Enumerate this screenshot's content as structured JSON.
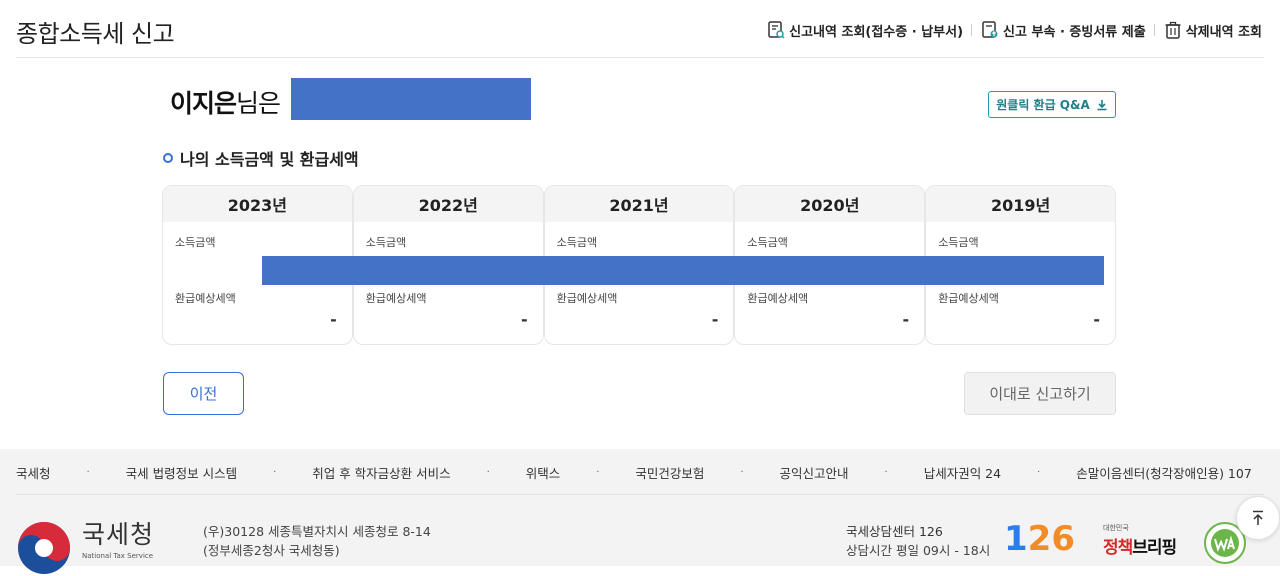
{
  "header": {
    "title": "종합소득세 신고",
    "links": {
      "history": "신고내역 조회(접수증 · 납부서)",
      "attach": "신고 부속 · 증빙서류 제출",
      "deleted": "삭제내역 조회"
    }
  },
  "main": {
    "user_name": "이지은",
    "user_suffix": "님은",
    "qa_button": "원클릭 환급 Q&A",
    "section_title": "나의 소득금액 및 환급세액",
    "years": [
      {
        "year": "2023년",
        "income_label": "소득금액",
        "refund_label": "환급예상세액",
        "refund_value": "-"
      },
      {
        "year": "2022년",
        "income_label": "소득금액",
        "refund_label": "환급예상세액",
        "refund_value": "-"
      },
      {
        "year": "2021년",
        "income_label": "소득금액",
        "refund_label": "환급예상세액",
        "refund_value": "-"
      },
      {
        "year": "2020년",
        "income_label": "소득금액",
        "refund_label": "환급예상세액",
        "refund_value": "-"
      },
      {
        "year": "2019년",
        "income_label": "소득금액",
        "refund_label": "환급예상세액",
        "refund_value": "-"
      }
    ],
    "prev_button": "이전",
    "submit_button": "이대로 신고하기"
  },
  "footer": {
    "links": [
      "국세청",
      "국세 법령정보 시스템",
      "취업 후 학자금상환 서비스",
      "위택스",
      "국민건강보험",
      "공익신고안내",
      "납세자권익 24",
      "손말이음센터(청각장애인용) 107"
    ],
    "separator": "·",
    "nts_name": "국세청",
    "nts_sub": "National Tax Service",
    "address_line1": "(우)30128 세종특별자치시 세종청로 8-14",
    "address_line2": "(정부세종2청사 국세청동)",
    "center_name": "국세상담센터 126",
    "center_hours": "상담시간 평일 09시 - 18시",
    "logo_126": "126",
    "briefing_small": "대한민국",
    "briefing_big_red": "정책",
    "briefing_big": "브리핑"
  },
  "colors": {
    "accent": "#3b6fd4",
    "teal": "#2b9aa6",
    "mask": "#4472c4",
    "footer_bg": "#f3f3f3"
  },
  "icons": [
    "document-search-icon",
    "upload-document-icon",
    "trash-icon",
    "download-icon",
    "scroll-top-icon"
  ]
}
